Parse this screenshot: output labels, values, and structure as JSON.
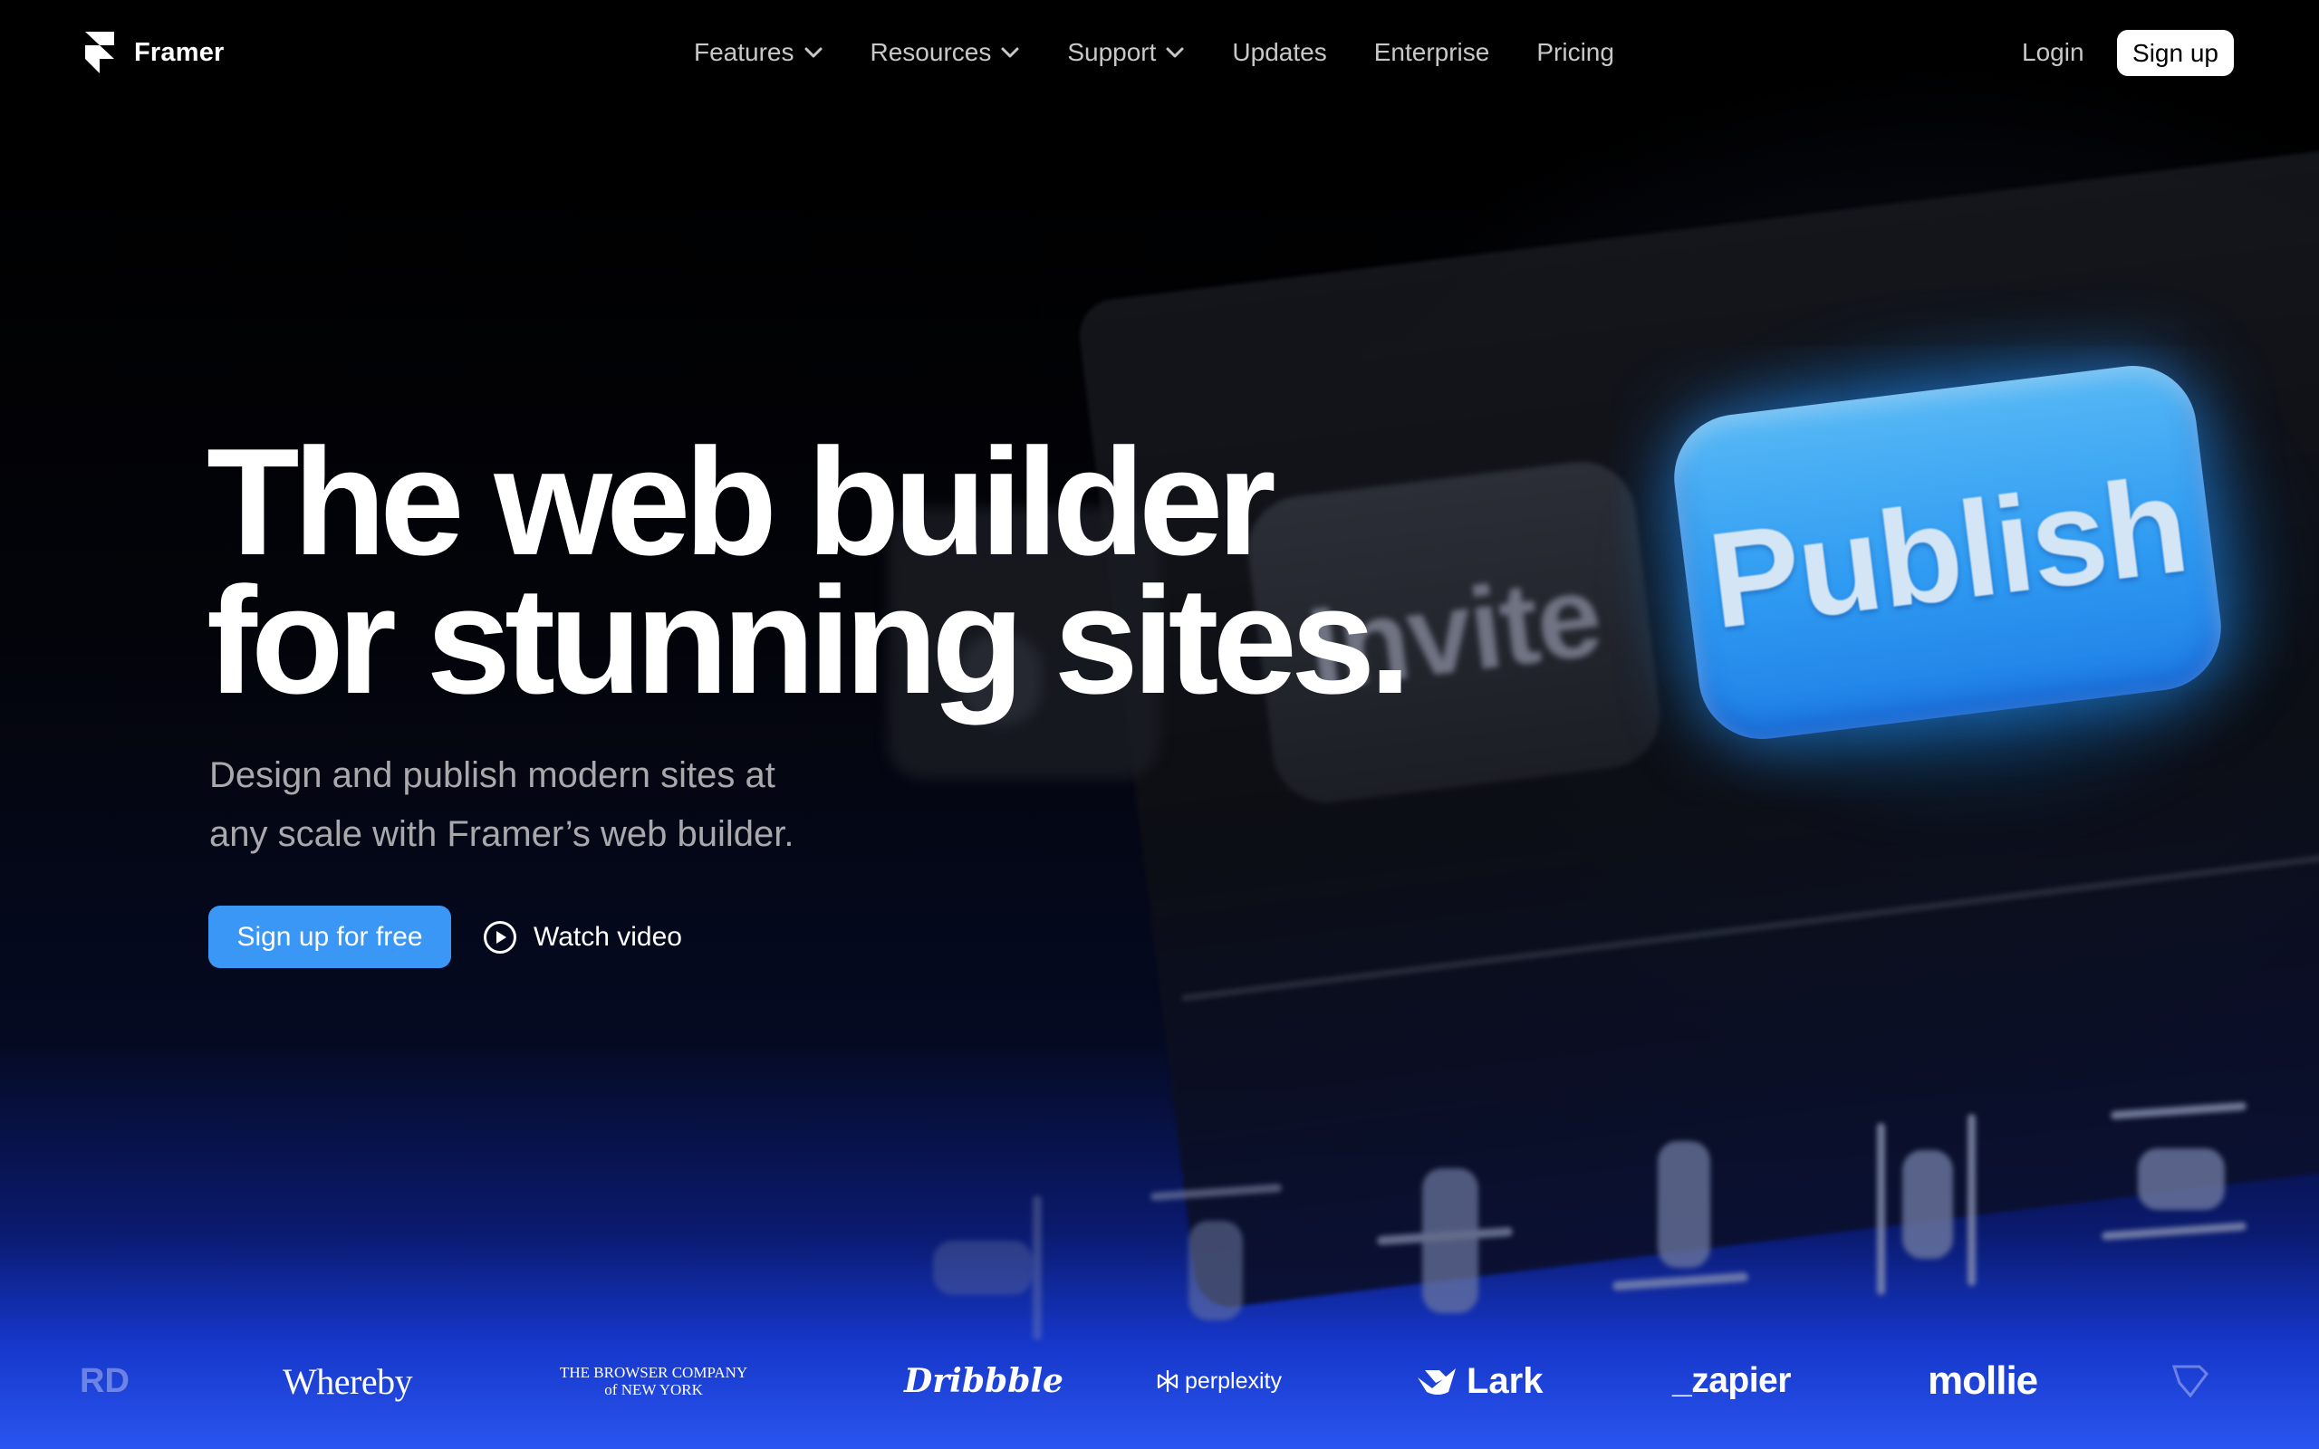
{
  "nav": {
    "brand": "Framer",
    "items": [
      {
        "label": "Features",
        "has_dropdown": true
      },
      {
        "label": "Resources",
        "has_dropdown": true
      },
      {
        "label": "Support",
        "has_dropdown": true
      },
      {
        "label": "Updates",
        "has_dropdown": false
      },
      {
        "label": "Enterprise",
        "has_dropdown": false
      },
      {
        "label": "Pricing",
        "has_dropdown": false
      }
    ],
    "login": "Login",
    "signup": "Sign up"
  },
  "hero": {
    "title_line1": "The web builder",
    "title_line2": "for stunning sites.",
    "subtitle_line1": "Design and publish modern sites at",
    "subtitle_line2": "any scale with Framer’s web builder.",
    "cta_label": "Sign up for free",
    "watch_label": "Watch video"
  },
  "scene": {
    "invite_label": "Invite",
    "publish_label": "Publish"
  },
  "logos": {
    "edge_left": "RD",
    "whereby": "Whereby",
    "browser_line1": "THE BROWSER COMPANY",
    "browser_line2": "of NEW YORK",
    "dribbble": "Dribbble",
    "perplexity": "perplexity",
    "lark": "Lark",
    "zapier": "_zapier",
    "mollie": "mollie"
  },
  "colors": {
    "background": "#000000",
    "primary_button": "#3b97f5",
    "publish_button": "#4aaef5",
    "bottom_glow": "#2a55f0"
  }
}
